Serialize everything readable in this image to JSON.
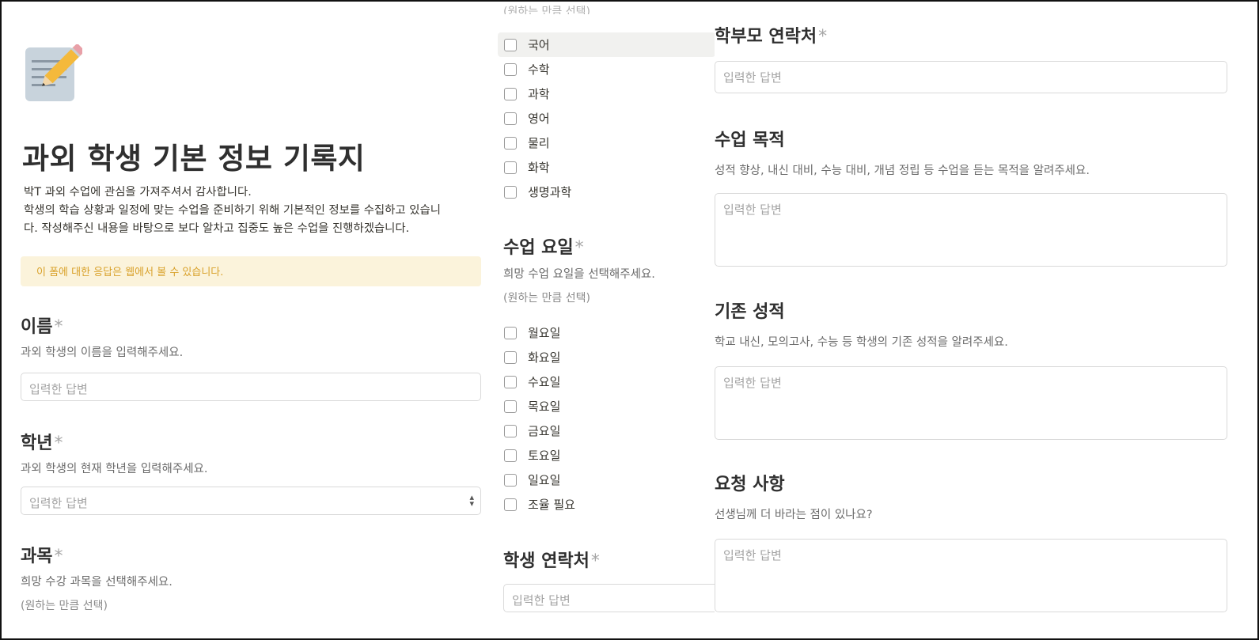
{
  "form": {
    "title": "과외 학생 기본 정보 기록지",
    "intro": [
      "박T 과외 수업에 관심을 가져주셔서 감사합니다.",
      "학생의 학습 상황과 일정에 맞는 수업을 준비하기 위해 기본적인 정보를 수집하고 있습니",
      "다. 작성해주신 내용을 바탕으로 보다 알차고 집중도 높은 수업을 진행하겠습니다."
    ],
    "notice": "이 폼에 대한 응답은 웹에서 볼 수 있습니다.",
    "required_mark": "*",
    "placeholder": "입력한 답변",
    "multi_hint": "(원하는 만큼 선택)",
    "clipped_hint": "(원하는 만큼 선택)"
  },
  "questions": {
    "name": {
      "title": "이름",
      "desc": "과외 학생의 이름을 입력해주세요."
    },
    "grade": {
      "title": "학년",
      "desc": "과외 학생의 현재 학년을 입력해주세요."
    },
    "subject": {
      "title": "과목",
      "desc": "희망 수강 과목을 선택해주세요."
    },
    "day": {
      "title": "수업 요일",
      "desc": "희망 수업 요일을 선택해주세요."
    },
    "student_contact": {
      "title": "학생 연락처"
    },
    "parent_contact": {
      "title": "학부모 연락처"
    },
    "purpose": {
      "title": "수업 목적",
      "desc": "성적 향상, 내신 대비, 수능 대비, 개념 정립 등 수업을 듣는 목적을 알려주세요."
    },
    "grades": {
      "title": "기존 성적",
      "desc": "학교 내신, 모의고사, 수능 등 학생의 기존 성적을 알려주세요."
    },
    "request": {
      "title": "요청 사항",
      "desc": "선생님께 더 바라는 점이 있나요?"
    }
  },
  "subjects": [
    "국어",
    "수학",
    "과학",
    "영어",
    "물리",
    "화학",
    "생명과학"
  ],
  "days": [
    "월요일",
    "화요일",
    "수요일",
    "목요일",
    "금요일",
    "토요일",
    "일요일",
    "조율 필요"
  ],
  "icons": {
    "logo": "memo-pencil-icon",
    "select": "chevron-updown-icon"
  }
}
